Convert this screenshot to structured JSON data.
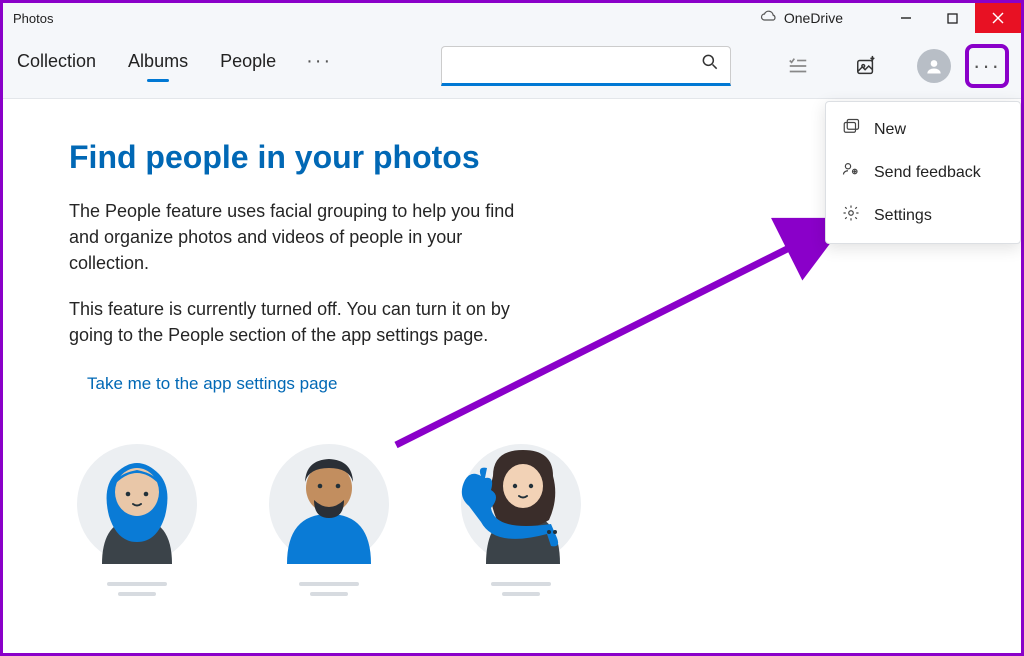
{
  "titlebar": {
    "app_name": "Photos",
    "onedrive_label": "OneDrive"
  },
  "nav": {
    "tabs": [
      "Collection",
      "Albums",
      "People"
    ],
    "active_index": 1,
    "search_placeholder": ""
  },
  "main": {
    "heading": "Find people in your photos",
    "para1": "The People feature uses facial grouping to help you find and organize photos and videos of people in your collection.",
    "para2": "This feature is currently turned off. You can turn it on by going to the People section of the app settings page.",
    "link": "Take me to the app settings page"
  },
  "menu": {
    "items": [
      {
        "icon": "new-icon",
        "label": "New"
      },
      {
        "icon": "feedback-icon",
        "label": "Send feedback"
      },
      {
        "icon": "settings-icon",
        "label": "Settings"
      }
    ]
  }
}
